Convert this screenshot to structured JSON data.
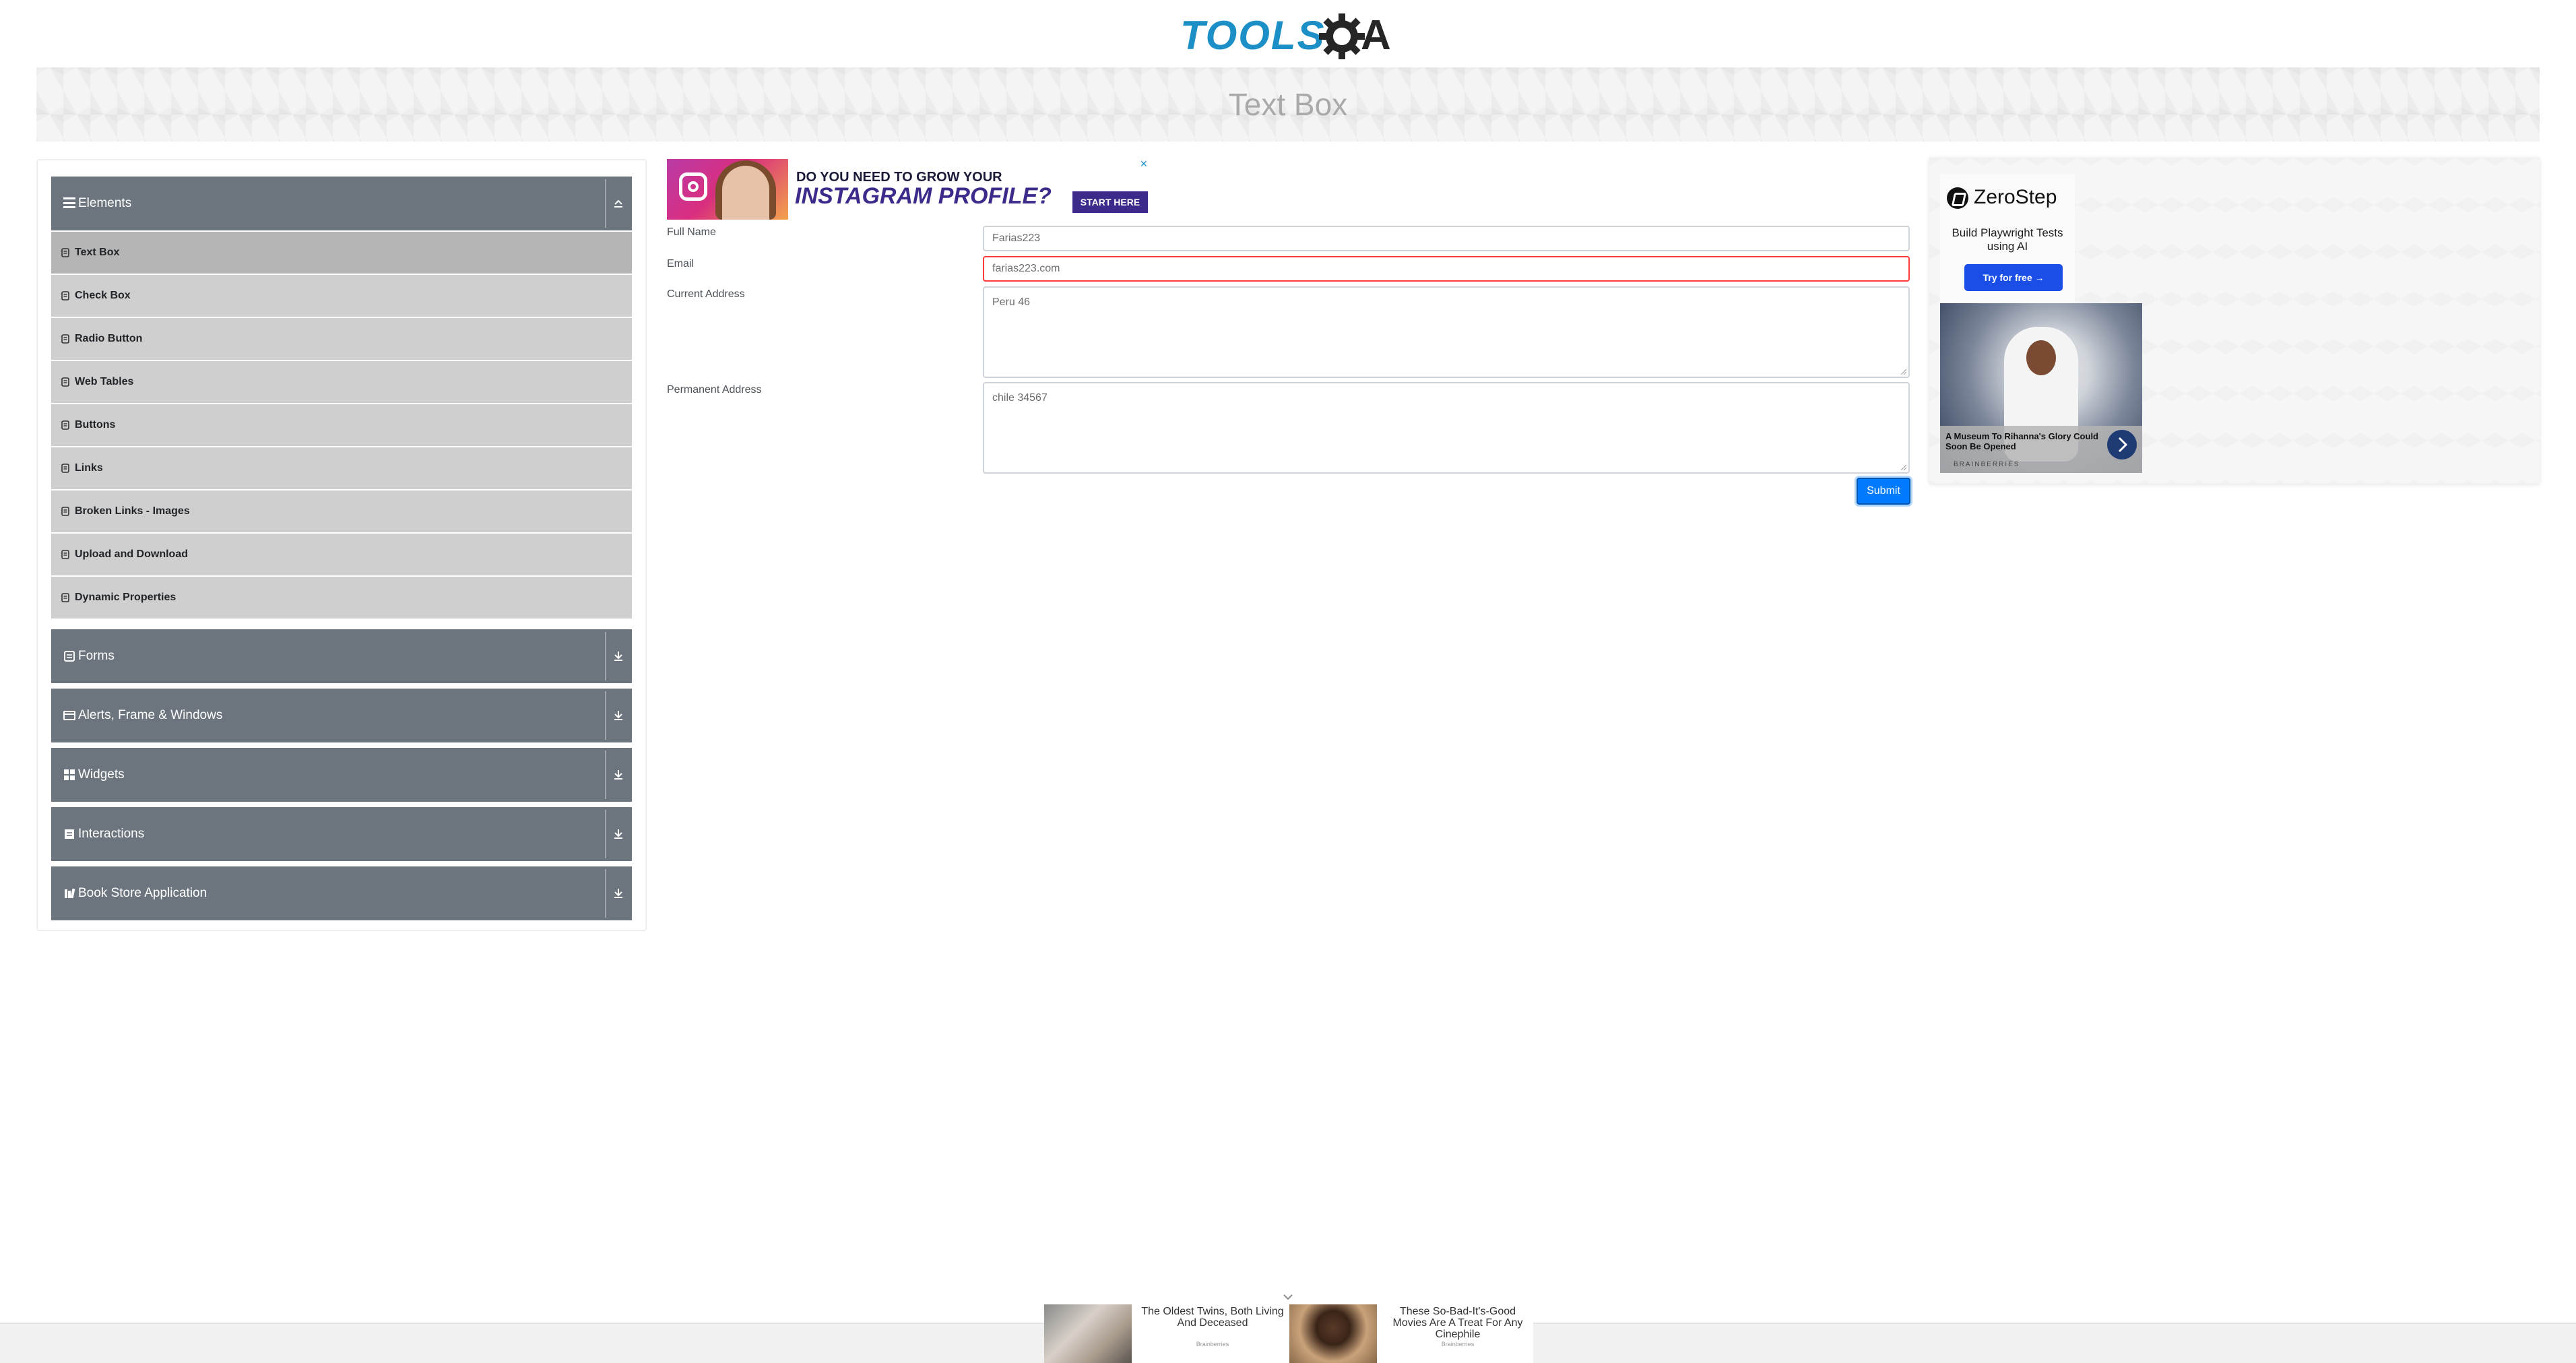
{
  "header": {
    "logo_text": "TOOLS",
    "logo_suffix": "A",
    "page_title": "Text Box"
  },
  "sidebar": {
    "groups": [
      {
        "label": "Elements",
        "icon": "hamburger-icon",
        "expanded": true
      },
      {
        "label": "Forms",
        "icon": "form-icon",
        "expanded": false
      },
      {
        "label": "Alerts, Frame & Windows",
        "icon": "window-icon",
        "expanded": false
      },
      {
        "label": "Widgets",
        "icon": "grid-icon",
        "expanded": false
      },
      {
        "label": "Interactions",
        "icon": "interaction-icon",
        "expanded": false
      },
      {
        "label": "Book Store Application",
        "icon": "book-icon",
        "expanded": false
      }
    ],
    "items": [
      {
        "label": "Text Box",
        "active": true
      },
      {
        "label": "Check Box"
      },
      {
        "label": "Radio Button"
      },
      {
        "label": "Web Tables"
      },
      {
        "label": "Buttons"
      },
      {
        "label": "Links"
      },
      {
        "label": "Broken Links - Images"
      },
      {
        "label": "Upload and Download"
      },
      {
        "label": "Dynamic Properties"
      }
    ]
  },
  "form": {
    "full_name_label": "Full Name",
    "full_name_value": "Farias223",
    "email_label": "Email",
    "email_value": "farias223.com",
    "current_address_label": "Current Address",
    "current_address_value": "Peru 46",
    "permanent_address_label": "Permanent Address",
    "permanent_address_value": "chile 34567",
    "submit_label": "Submit"
  },
  "ads": {
    "instagram": {
      "line1": "DO YOU NEED TO GROW YOUR",
      "line2": "INSTAGRAM PROFILE?",
      "cta": "START HERE",
      "close": "✕"
    },
    "zerostep": {
      "name": "ZeroStep",
      "tagline": "Build Playwright Tests using AI",
      "cta": "Try for free →"
    },
    "brainberries": {
      "caption": "A Museum To Rihanna's Glory Could Soon Be Opened",
      "source": "BRAINBERRIES"
    },
    "bottom": [
      {
        "title": "The Oldest Twins, Both Living And Deceased",
        "source": "Brainberries"
      },
      {
        "title": "These So-Bad-It's-Good Movies Are A Treat For Any Cinephile",
        "source": "Brainberries"
      }
    ]
  },
  "colors": {
    "accent": "#1c8fc7",
    "sidebar_header": "#6c757d",
    "sidebar_item": "#cfcfcf",
    "submit": "#007bff",
    "error_border": "#ff3b3b"
  }
}
